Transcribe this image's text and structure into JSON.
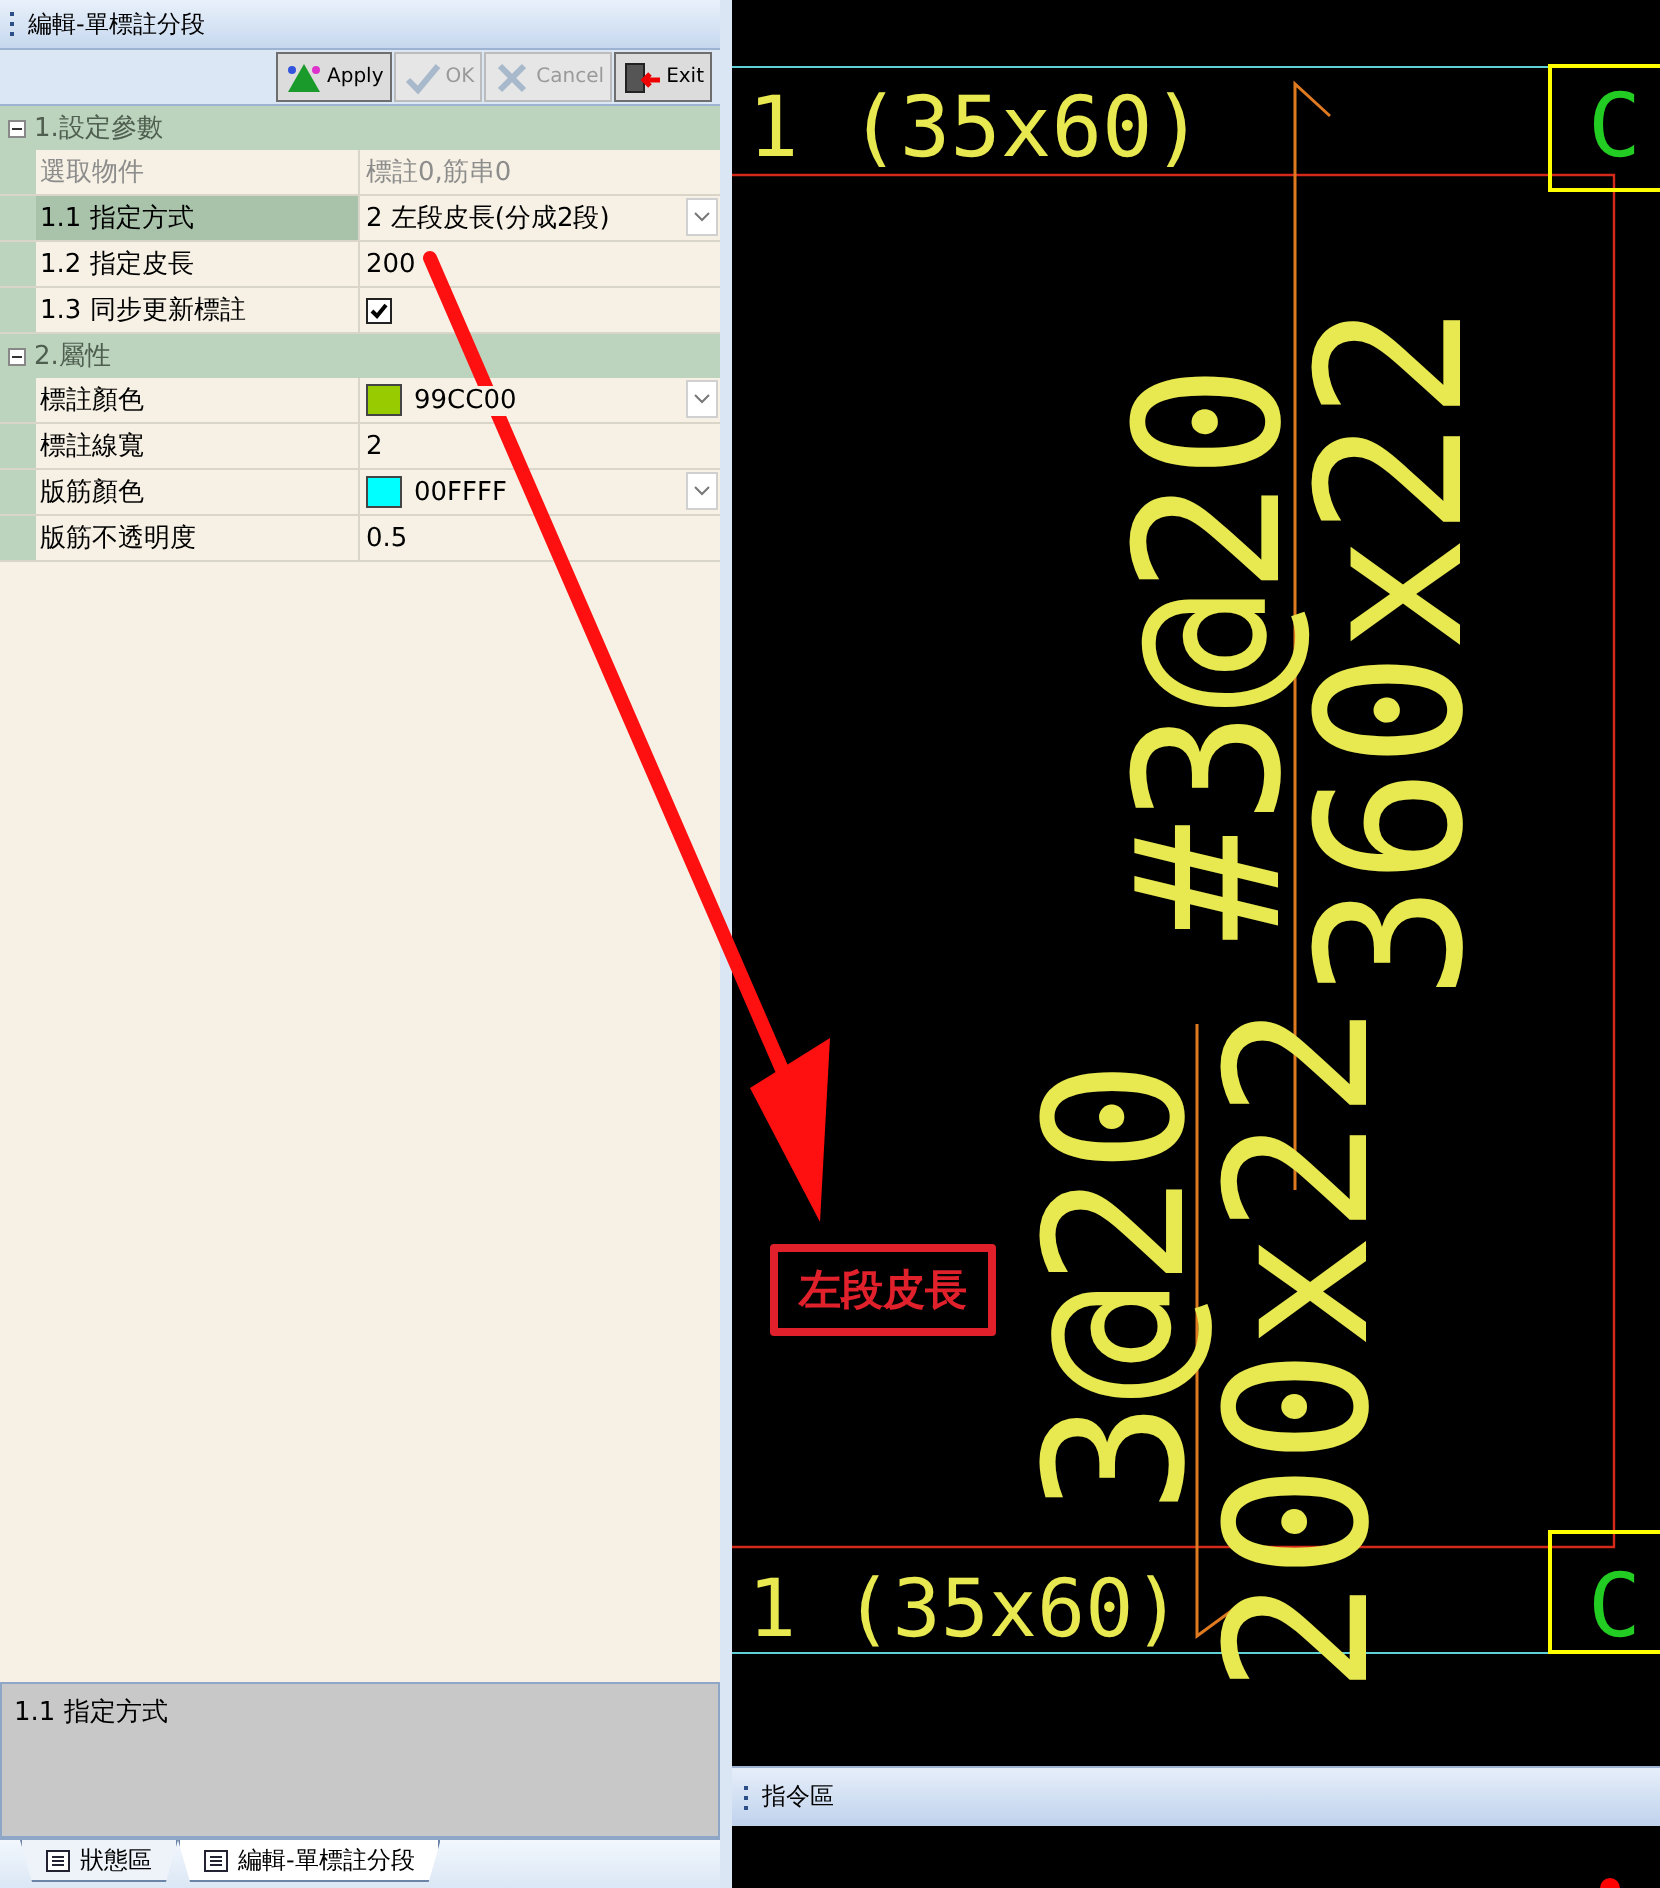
{
  "panel": {
    "title": "編輯-單標註分段",
    "toolbar": [
      {
        "label": "Apply",
        "kind": "apply",
        "disabled": false
      },
      {
        "label": "OK",
        "kind": "ok",
        "disabled": true
      },
      {
        "label": "Cancel",
        "kind": "cancel",
        "disabled": true
      },
      {
        "label": "Exit",
        "kind": "exit",
        "disabled": false
      }
    ],
    "categories": [
      {
        "label": "1.設定參數",
        "expanded": true,
        "rows": [
          {
            "label": "選取物件",
            "value": "標註0,筋串0",
            "kind": "text",
            "disabled": true,
            "selected": false
          },
          {
            "label": "1.1 指定方式",
            "value": "2 左段皮長(分成2段)",
            "kind": "dropdown",
            "disabled": false,
            "selected": true
          },
          {
            "label": "1.2 指定皮長",
            "value": "200",
            "kind": "text",
            "disabled": false,
            "selected": false
          },
          {
            "label": "1.3 同步更新標註",
            "kind": "checkbox",
            "checked": true,
            "disabled": false,
            "selected": false
          }
        ]
      },
      {
        "label": "2.屬性",
        "expanded": true,
        "rows": [
          {
            "label": "標註顏色",
            "value": "99CC00",
            "kind": "color",
            "color": "#99cc00",
            "disabled": false,
            "selected": false
          },
          {
            "label": "標註線寬",
            "value": "2",
            "kind": "text",
            "disabled": false,
            "selected": false
          },
          {
            "label": "版筋顏色",
            "value": "00FFFF",
            "kind": "color",
            "color": "#00ffff",
            "disabled": false,
            "selected": false
          },
          {
            "label": "版筋不透明度",
            "value": "0.5",
            "kind": "text",
            "disabled": false,
            "selected": false
          }
        ]
      }
    ],
    "description": "1.1 指定方式",
    "tabs": [
      {
        "label": "狀態區",
        "selected": false
      },
      {
        "label": "編輯-單標註分段",
        "selected": true
      }
    ]
  },
  "canvas": {
    "labels": [
      {
        "text": "1 (35x60)",
        "color": "#e8e850"
      },
      {
        "text": "#3@20",
        "color": "#e8e850"
      },
      {
        "text": "360x22",
        "color": "#e8e850"
      },
      {
        "text": "3@20",
        "color": "#e8e850"
      },
      {
        "text": "200x22",
        "color": "#e8e850"
      },
      {
        "text": "1 (35x60)",
        "color": "#e8e850"
      },
      {
        "text": "C",
        "color": "#22cc22"
      },
      {
        "text": "C",
        "color": "#22cc22"
      }
    ]
  },
  "annotation": {
    "label": "左段皮長"
  },
  "command_area": {
    "title": "指令區"
  }
}
